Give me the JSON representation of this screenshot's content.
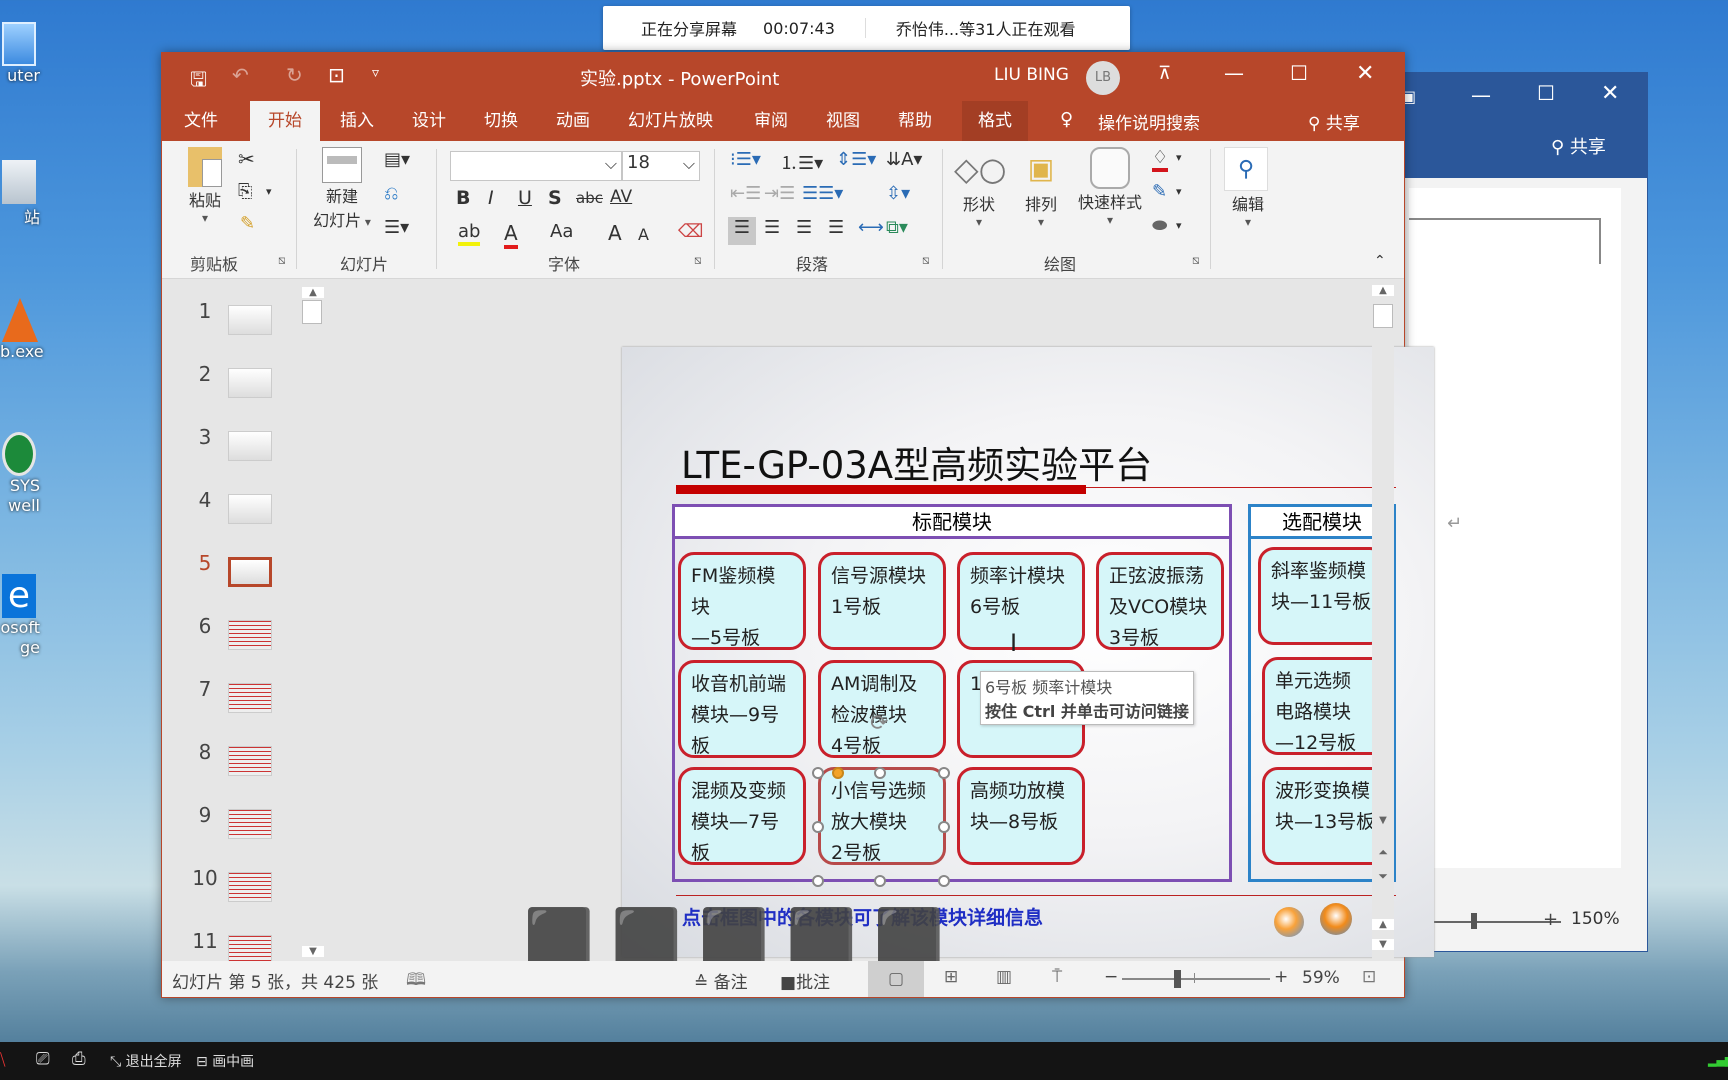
{
  "share_bar": {
    "status": "正在分享屏幕",
    "timer": "00:07:43",
    "viewers": "乔怡伟...等31人正在观看"
  },
  "desktop_icons": [
    {
      "label": "uter",
      "icon": "computer-icon"
    },
    {
      "label": "站",
      "icon": "recycle-bin-icon"
    },
    {
      "label": "b.exe",
      "icon": "matlab-icon"
    },
    {
      "label": "SYS well",
      "icon": "ansys-icon"
    },
    {
      "label": "osoft ge",
      "icon": "edge-icon"
    }
  ],
  "window": {
    "title": "实验.pptx  -  PowerPoint",
    "user_name": "LIU BING",
    "user_initials": "LB",
    "quick_access": [
      "save-icon",
      "undo-icon",
      "redo-icon",
      "start-slideshow-icon",
      "customize-icon"
    ]
  },
  "tabs": [
    {
      "label": "文件"
    },
    {
      "label": "开始",
      "active": true
    },
    {
      "label": "插入"
    },
    {
      "label": "设计"
    },
    {
      "label": "切换"
    },
    {
      "label": "动画"
    },
    {
      "label": "幻灯片放映"
    },
    {
      "label": "审阅"
    },
    {
      "label": "视图"
    },
    {
      "label": "帮助"
    },
    {
      "label": "格式"
    }
  ],
  "tell_me": "操作说明搜索",
  "share_label": "共享",
  "ribbon": {
    "clipboard": {
      "label": "剪贴板",
      "paste": "粘贴"
    },
    "slides": {
      "label": "幻灯片",
      "new_slide_1": "新建",
      "new_slide_2": "幻灯片"
    },
    "font": {
      "label": "字体",
      "font_name": "",
      "font_size": "18",
      "buttons": [
        "B",
        "I",
        "U",
        "S",
        "abc",
        "AV",
        "Aa",
        "A",
        "A"
      ]
    },
    "paragraph": {
      "label": "段落"
    },
    "drawing": {
      "label": "绘图",
      "shapes": "形状",
      "arrange": "排列",
      "quick_styles": "快速样式"
    },
    "editing": {
      "label": "编辑"
    }
  },
  "thumbnails": [
    {
      "num": "1"
    },
    {
      "num": "2"
    },
    {
      "num": "3"
    },
    {
      "num": "4"
    },
    {
      "num": "5",
      "selected": true
    },
    {
      "num": "6"
    },
    {
      "num": "7"
    },
    {
      "num": "8"
    },
    {
      "num": "9"
    },
    {
      "num": "10"
    },
    {
      "num": "11"
    }
  ],
  "slide": {
    "title": "LTE-GP-03A型高频实验平台",
    "standard_header": "标配模块",
    "optional_header": "选配模块",
    "standard_modules": [
      {
        "line1": "FM鉴频模块",
        "line2": "—5号板"
      },
      {
        "line1": "信号源模块",
        "line2": "1号板"
      },
      {
        "line1": "频率计模块",
        "line2": "6号板"
      },
      {
        "line1": "正弦波振荡",
        "line2": "及VCO模块",
        "line3": "3号板"
      },
      {
        "line1": "收音机前端",
        "line2": "模块—9号板"
      },
      {
        "line1": "AM调制及",
        "line2": "检波模块",
        "line3": "4号板"
      },
      {
        "line1": "",
        "line2": "10号板"
      },
      {
        "line1": "混频及变频",
        "line2": "模块—7号板"
      },
      {
        "line1": "小信号选频",
        "line2": "放大模块",
        "line3": "2号板"
      },
      {
        "line1": "高频功放模",
        "line2": "块—8号板"
      }
    ],
    "optional_modules": [
      {
        "line1": "斜率鉴频模",
        "line2": "块—11号板"
      },
      {
        "line1": "单元选频",
        "line2": "电路模块",
        "line3": "—12号板"
      },
      {
        "line1": "波形变换模",
        "line2": "块—13号板"
      }
    ],
    "footer_note": "点击框图中的各模块可了解该模块详细信息",
    "tooltip_line1": "6号板 频率计模块",
    "tooltip_line2": "按住 Ctrl 并单击可访问链接"
  },
  "status_bar": {
    "slide_info": "幻灯片 第 5 张，共 425 张",
    "notes": "备注",
    "comments": "批注",
    "zoom_minus": "−",
    "zoom_plus": "+",
    "zoom_level": "59%",
    "zoom_fraction": 0.35
  },
  "back_window": {
    "share_label": "共享",
    "zoom_level": "150%"
  },
  "taskbar": {
    "exit_fullscreen": "退出全屏",
    "pip": "画中画"
  },
  "colors": {
    "accent": "#b7472a",
    "word_blue": "#2b579a",
    "module_border": "#c9202b",
    "module_fill": "#d6f6f9",
    "standard_border": "#7d4fb3",
    "optional_border": "#2c83c8"
  }
}
